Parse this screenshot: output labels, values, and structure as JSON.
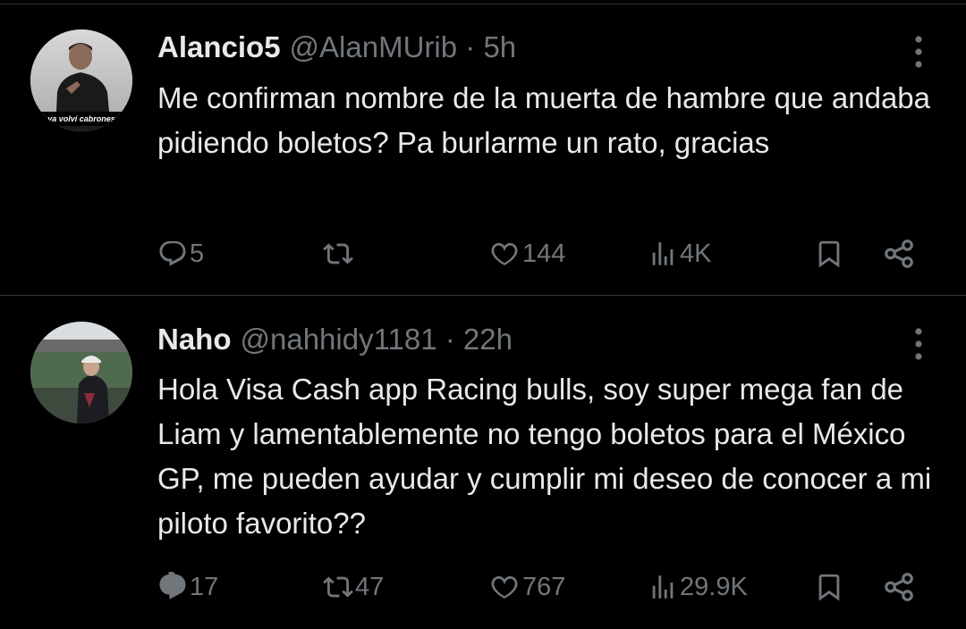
{
  "tweets": [
    {
      "author_name": "Alancio5",
      "handle": "@AlanMUrib",
      "separator": "·",
      "time": "5h",
      "avatar_caption": "ya volví cabrones",
      "text": "Me confirman nombre de la muerta de hambre que andaba pidiendo boletos? Pa burlarme un rato, gracias",
      "stats": {
        "replies": "5",
        "retweets": "",
        "likes": "144",
        "views": "4K"
      }
    },
    {
      "author_name": "Naho",
      "handle": "@nahhidy1181",
      "separator": "·",
      "time": "22h",
      "text": "Hola Visa Cash app Racing bulls, soy super mega fan de Liam y lamentablemente no tengo boletos para el México GP, me pueden ayudar y cumplir mi deseo de conocer a mi piloto favorito??",
      "stats": {
        "replies": "17",
        "retweets": "47",
        "likes": "767",
        "views": "29.9K"
      }
    }
  ],
  "icons": {
    "reply": "reply-icon",
    "retweet": "retweet-icon",
    "like": "heart-icon",
    "views": "views-icon",
    "bookmark": "bookmark-icon",
    "share": "share-icon",
    "more": "more-vertical-icon"
  },
  "colors": {
    "background": "#000000",
    "text": "#e7e9ea",
    "secondary": "#71767b",
    "divider": "#2f3336"
  }
}
